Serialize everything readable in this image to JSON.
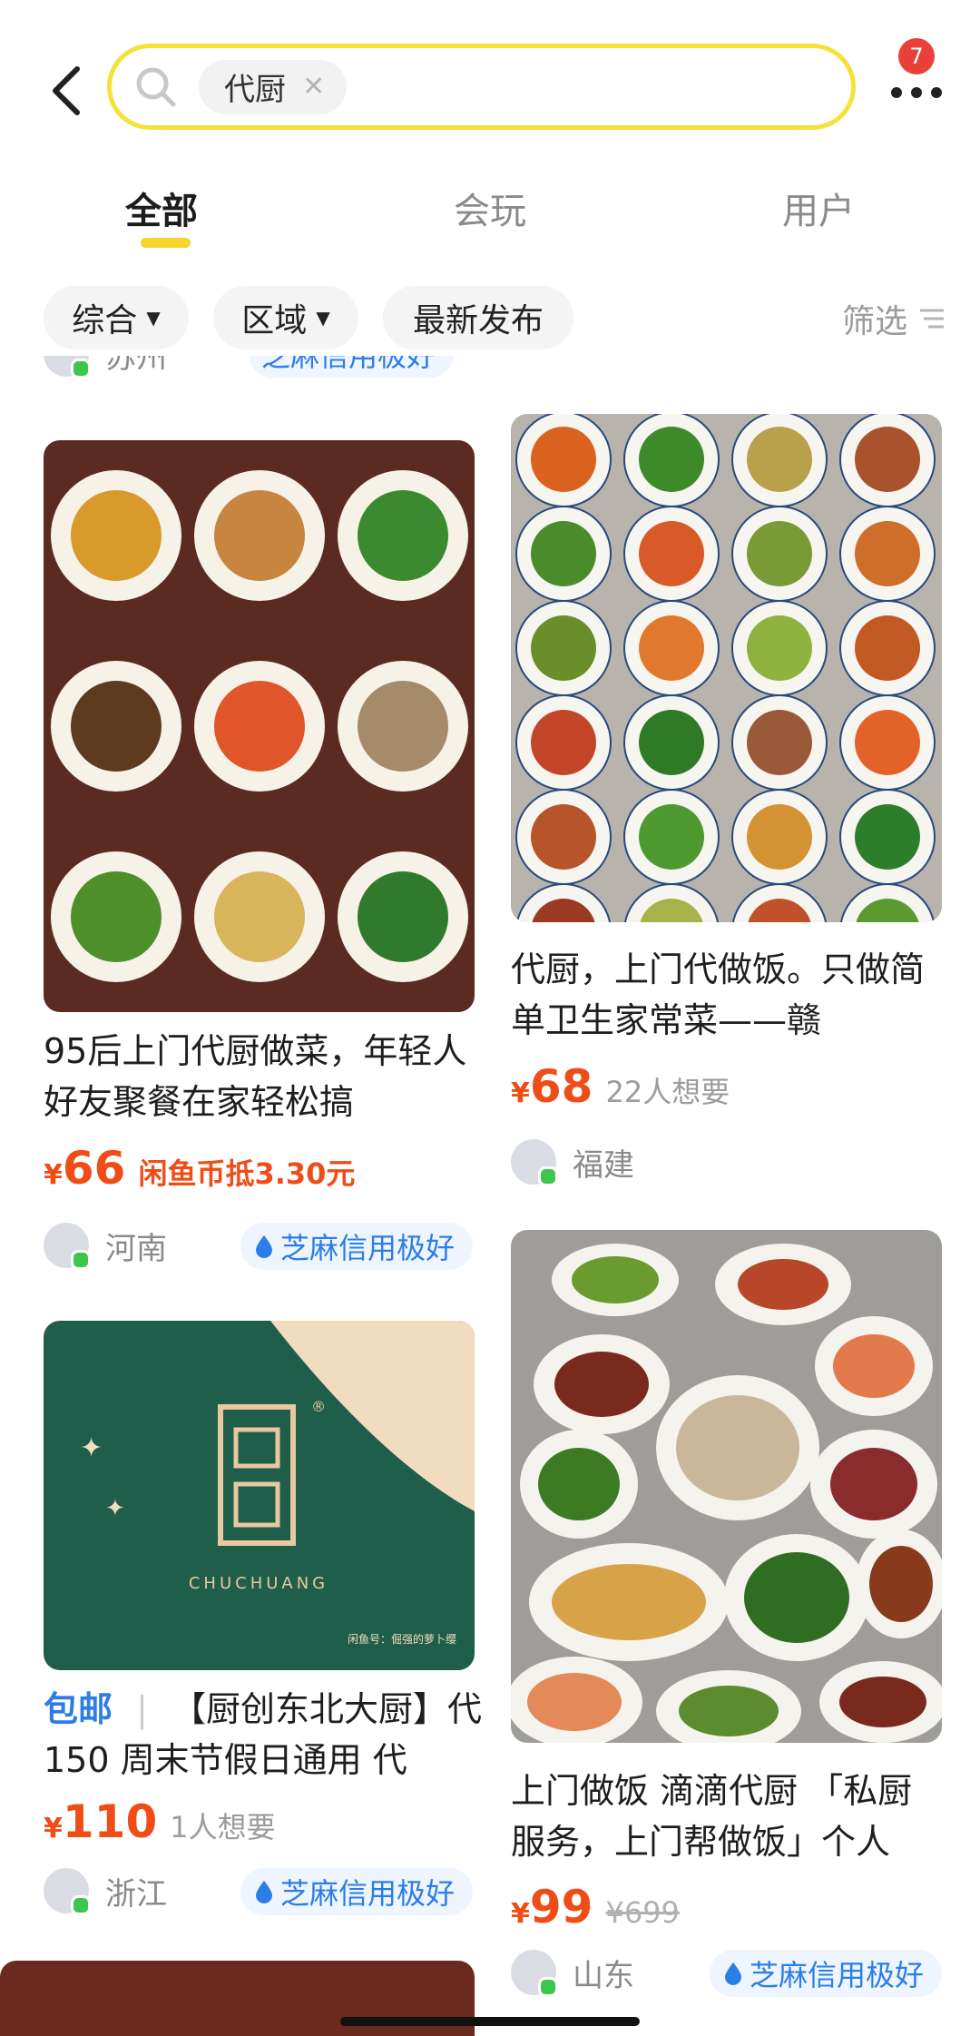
{
  "header": {
    "search_chip": "代厨",
    "notification_count": "7"
  },
  "tabs": [
    {
      "label": "全部"
    },
    {
      "label": "会玩"
    },
    {
      "label": "用户"
    }
  ],
  "filters": {
    "sort": "综合",
    "region": "区域",
    "latest": "最新发布",
    "screen": "筛选"
  },
  "partial_top": {
    "location": "苏州",
    "credit": "芝麻信用极好"
  },
  "cards": [
    {
      "title": "95后上门代厨做菜，年轻人好友聚餐在家轻松搞",
      "currency": "¥",
      "price": "66",
      "extra": "闲鱼币抵3.30元",
      "location": "河南",
      "credit": "芝麻信用极好"
    },
    {
      "title": "代厨，上门代做饭。只做简单卫生家常菜——赣",
      "currency": "¥",
      "price": "68",
      "extra": "22人想要",
      "location": "福建"
    },
    {
      "badge": "包邮",
      "title": "【厨创东北大厨】代150 周末节假日通用 代",
      "currency": "¥",
      "price": "110",
      "extra": "1人想要",
      "location": "浙江",
      "credit": "芝麻信用极好",
      "logo_text": "CHUCHUANG",
      "logo_watermark": "闲鱼号：倔强的萝卜缨"
    },
    {
      "title": "上门做饭 滴滴代厨 「私厨服务，上门帮做饭」个人",
      "currency": "¥",
      "price": "99",
      "original_price": "¥699",
      "location": "山东",
      "credit": "芝麻信用极好"
    }
  ],
  "colors": {
    "accent_yellow": "#f5e13a",
    "price_orange": "#ef4d17",
    "credit_blue": "#2c7de8",
    "logo_green": "#1f5e4a"
  }
}
